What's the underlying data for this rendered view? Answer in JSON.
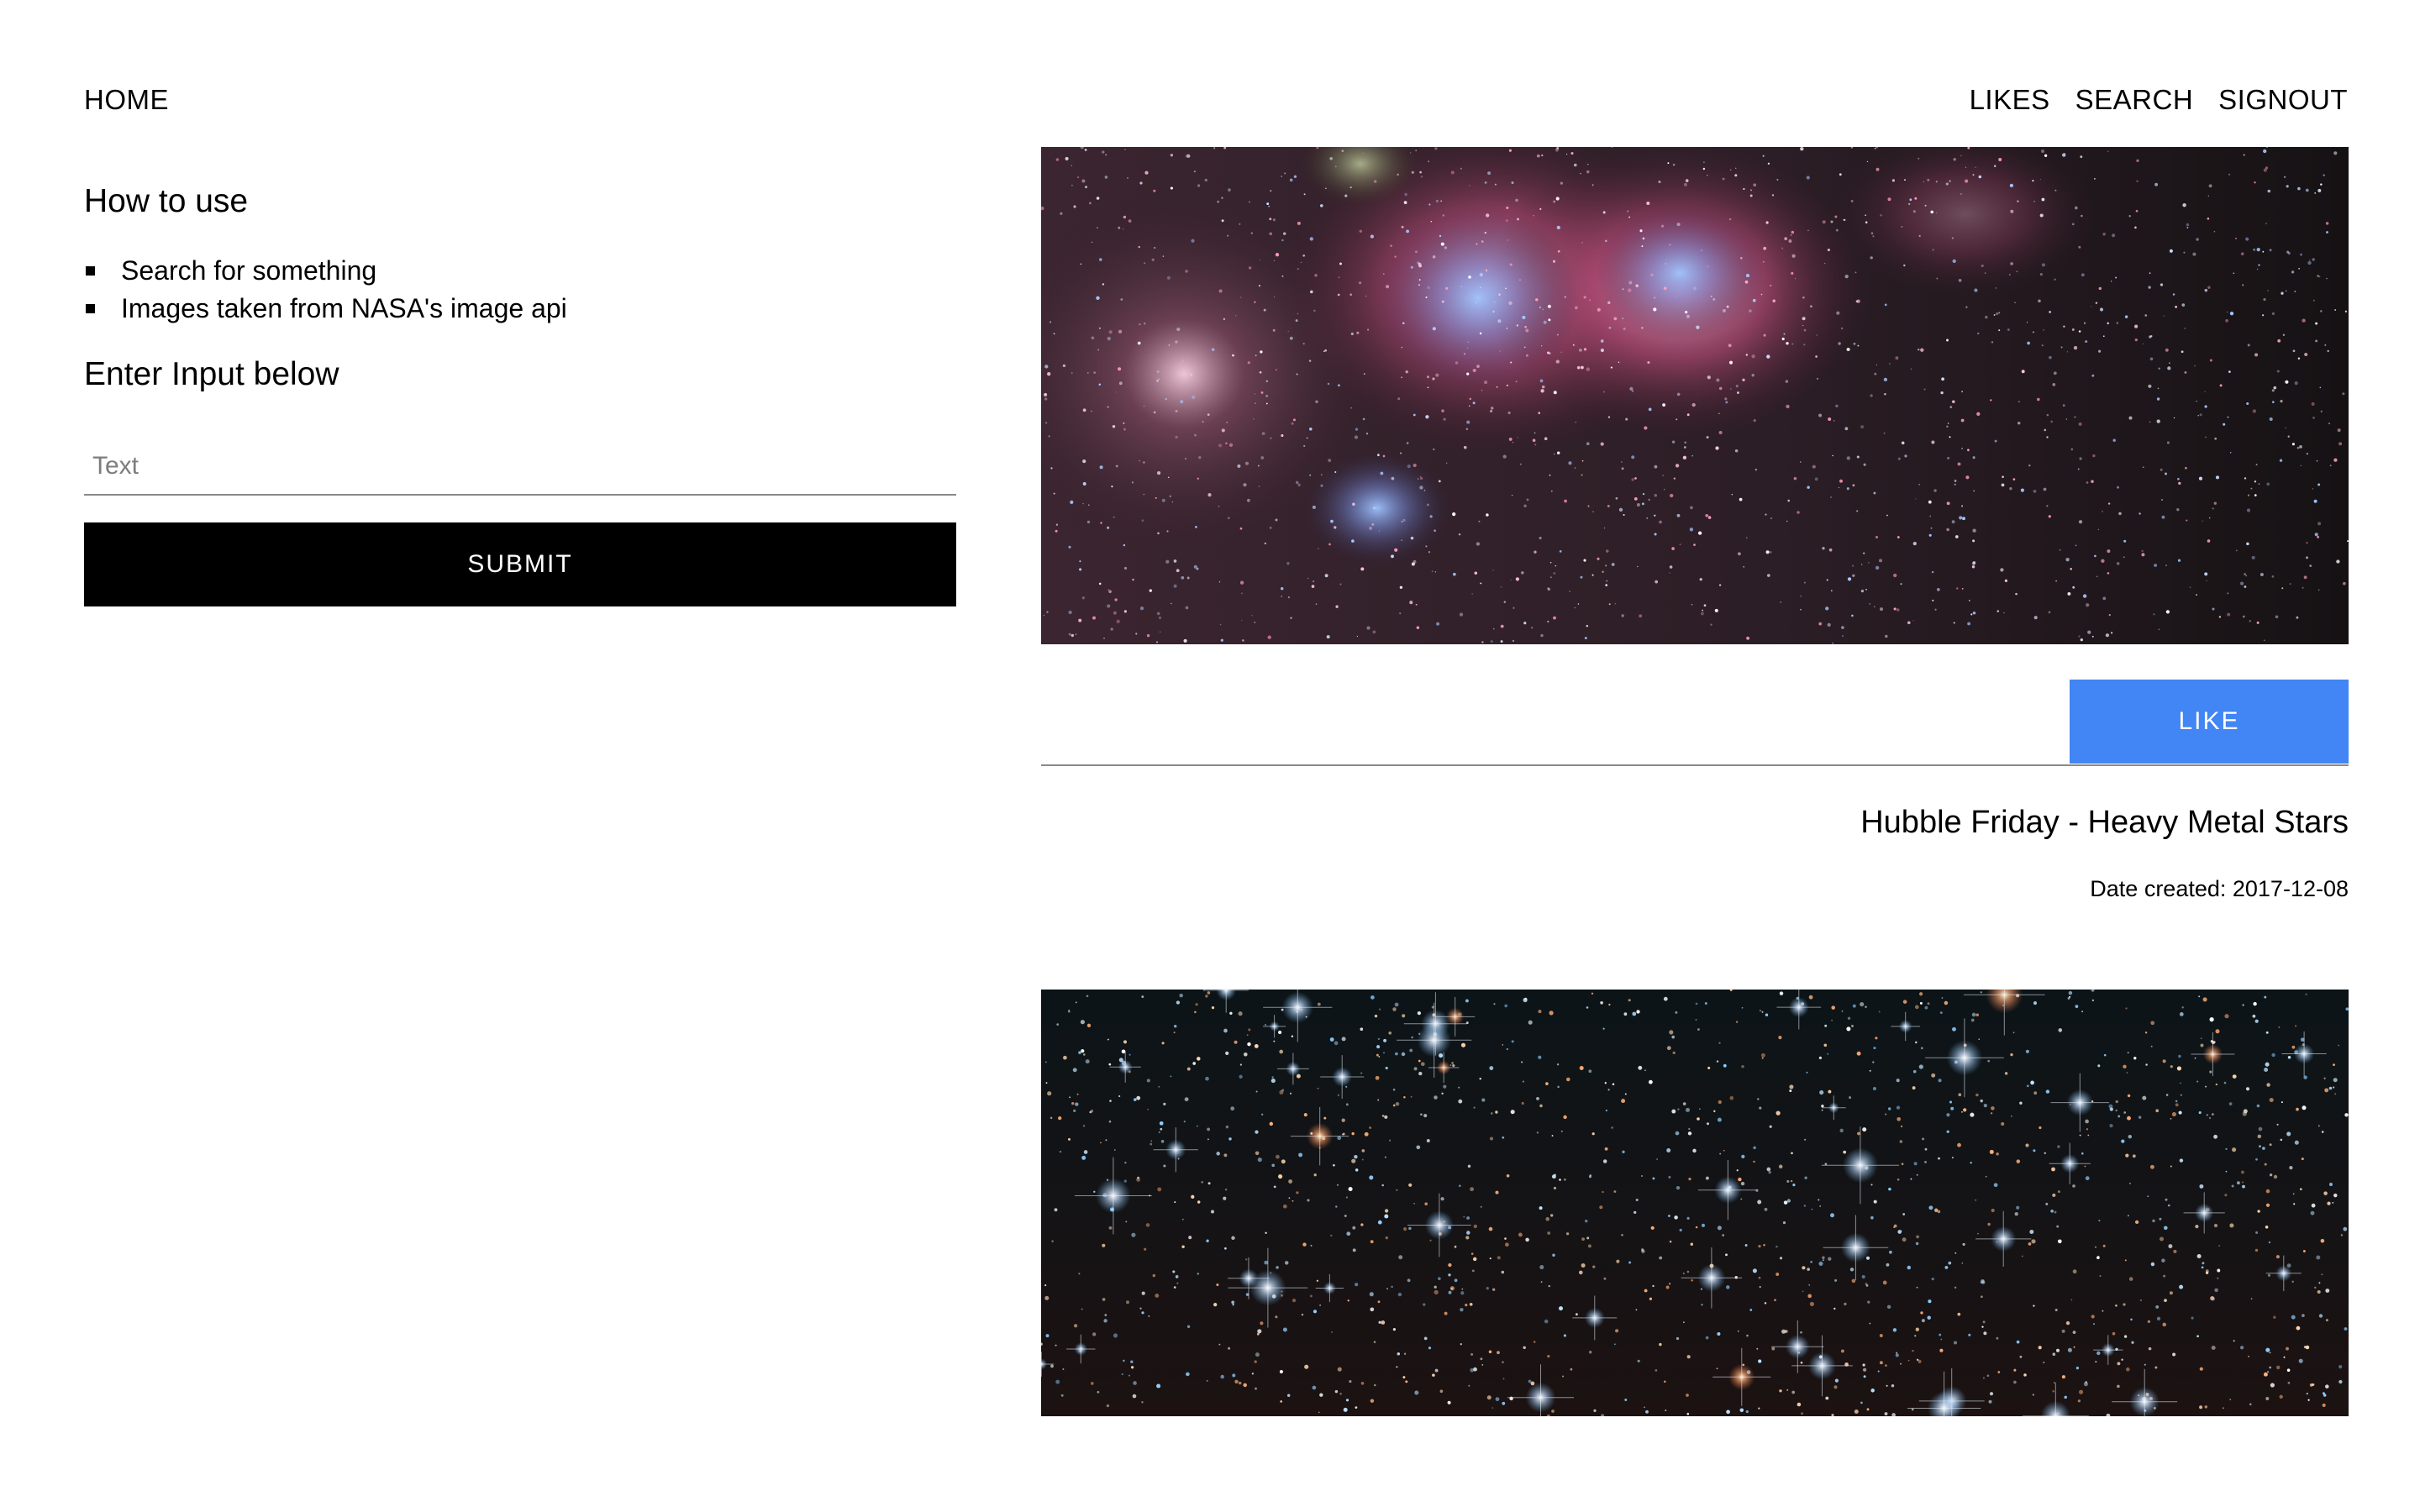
{
  "nav": {
    "home": "HOME",
    "likes": "LIKES",
    "search": "SEARCH",
    "signout": "SIGNOUT"
  },
  "instructions": {
    "heading": "How to use",
    "items": [
      "Search for something",
      "Images taken from NASA's image api"
    ],
    "input_heading": "Enter Input below"
  },
  "search_form": {
    "placeholder": "Text",
    "value": "",
    "submit_label": "SUBMIT"
  },
  "results": [
    {
      "like_label": "LIKE",
      "title": "Hubble Friday - Heavy Metal Stars",
      "date": "Date created: 2017-12-08"
    }
  ],
  "colors": {
    "like_button": "#4285f4",
    "submit_button": "#000000",
    "divider": "#8a8a8a"
  }
}
